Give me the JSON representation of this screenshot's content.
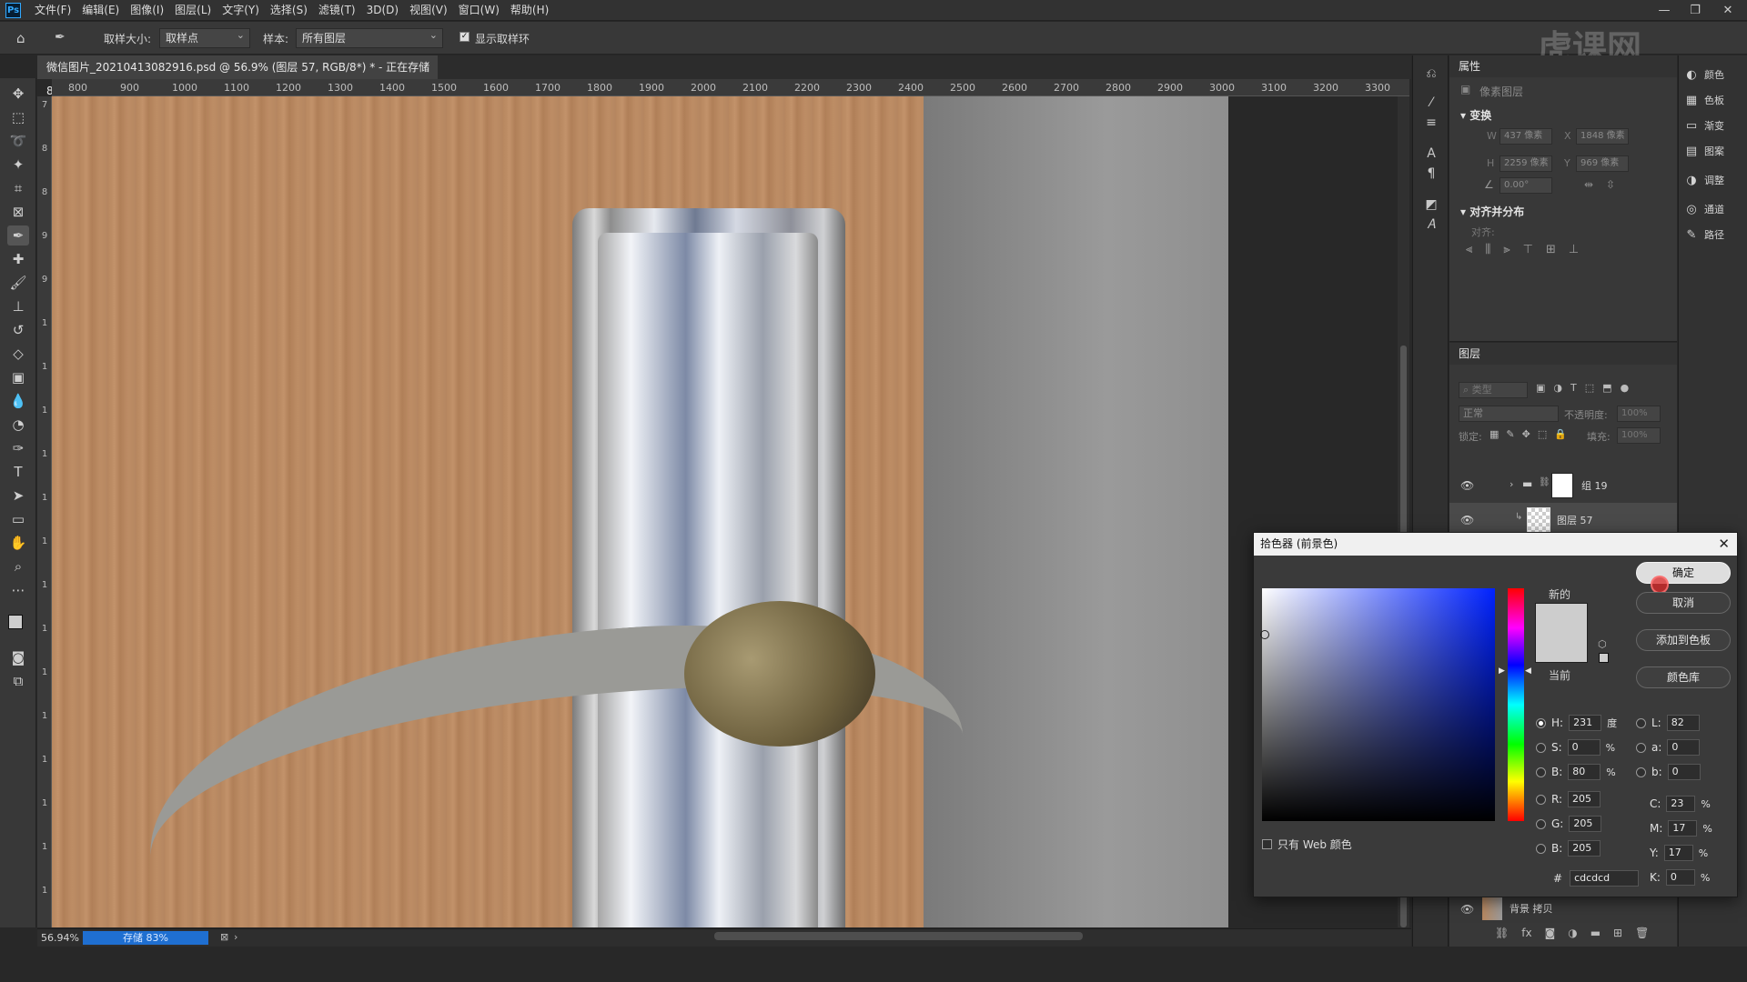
{
  "app": {
    "logo": "Ps"
  },
  "menu": [
    "文件(F)",
    "编辑(E)",
    "图像(I)",
    "图层(L)",
    "文字(Y)",
    "选择(S)",
    "滤镜(T)",
    "3D(D)",
    "视图(V)",
    "窗口(W)",
    "帮助(H)"
  ],
  "window_controls": [
    "—",
    "❐",
    "✕"
  ],
  "options": {
    "sample_size_label": "取样大小:",
    "sample_size_value": "取样点",
    "sample_label": "样本:",
    "sample_value": "所有图层",
    "show_ring_label": "显示取样环",
    "show_ring_checked": true
  },
  "document": {
    "tab_title": "微信图片_20210413082916.psd @ 56.9% (图层 57, RGB/8*) * - 正在存储 83%",
    "zoom": "56.94%",
    "saving_status": "存储 83%",
    "ruler_h": [
      "800",
      "900",
      "1000",
      "1100",
      "1200",
      "1300",
      "1400",
      "1500",
      "1600",
      "1700",
      "1800",
      "1900",
      "2000",
      "2100",
      "2200",
      "2300",
      "2400",
      "2500",
      "2600",
      "2700",
      "2800",
      "2900",
      "3000",
      "3100",
      "3200",
      "3300"
    ],
    "ruler_v": [
      "7",
      "8",
      "8",
      "9",
      "9",
      "1",
      "1",
      "1",
      "1",
      "1",
      "1",
      "1",
      "1",
      "1",
      "1",
      "1",
      "1",
      "1",
      "1"
    ]
  },
  "watermark": "虎课网",
  "properties": {
    "tab": "属性",
    "pixel_layer": "像素图层",
    "transform_title": "变换",
    "w_label": "W",
    "w_value": "437 像素",
    "x_label": "X",
    "x_value": "1848 像素",
    "h_label": "H",
    "h_value": "2259 像素",
    "y_label": "Y",
    "y_value": "969 像素",
    "angle_value": "0.00°",
    "align_title": "对齐并分布",
    "align_label": "对齐:"
  },
  "layers": {
    "tab": "图层",
    "search_placeholder": "类型",
    "blend_mode": "正常",
    "opacity_label": "不透明度:",
    "opacity_value": "100%",
    "lock_label": "锁定:",
    "fill_label": "填充:",
    "fill_value": "100%",
    "rows": [
      {
        "name": "组 19"
      },
      {
        "name": "图层 57"
      },
      {
        "name": "背景 拷贝"
      }
    ]
  },
  "right_panels": [
    {
      "icon": "◐",
      "label": "颜色"
    },
    {
      "icon": "▦",
      "label": "色板"
    },
    {
      "icon": "▭",
      "label": "渐变"
    },
    {
      "icon": "▤",
      "label": "图案"
    },
    {
      "icon": "◑",
      "label": "调整"
    },
    {
      "icon": "◎",
      "label": "通道"
    },
    {
      "icon": "✎",
      "label": "路径"
    }
  ],
  "color_picker": {
    "title": "拾色器 (前景色)",
    "new_label": "新的",
    "current_label": "当前",
    "ok": "确定",
    "cancel": "取消",
    "add_swatch": "添加到色板",
    "color_library": "颜色库",
    "web_only": "只有 Web 颜色",
    "new_color": "#cdcdcd",
    "current_color": "#cdcdcd",
    "H": {
      "label": "H:",
      "value": "231",
      "unit": "度"
    },
    "S": {
      "label": "S:",
      "value": "0",
      "unit": "%"
    },
    "Bv": {
      "label": "B:",
      "value": "80",
      "unit": "%"
    },
    "R": {
      "label": "R:",
      "value": "205"
    },
    "G": {
      "label": "G:",
      "value": "205"
    },
    "Bc": {
      "label": "B:",
      "value": "205"
    },
    "L": {
      "label": "L:",
      "value": "82"
    },
    "a": {
      "label": "a:",
      "value": "0"
    },
    "b": {
      "label": "b:",
      "value": "0"
    },
    "C": {
      "label": "C:",
      "value": "23",
      "unit": "%"
    },
    "M": {
      "label": "M:",
      "value": "17",
      "unit": "%"
    },
    "Y": {
      "label": "Y:",
      "value": "17",
      "unit": "%"
    },
    "K": {
      "label": "K:",
      "value": "0",
      "unit": "%"
    },
    "hex_label": "#",
    "hex": "cdcdcd"
  }
}
